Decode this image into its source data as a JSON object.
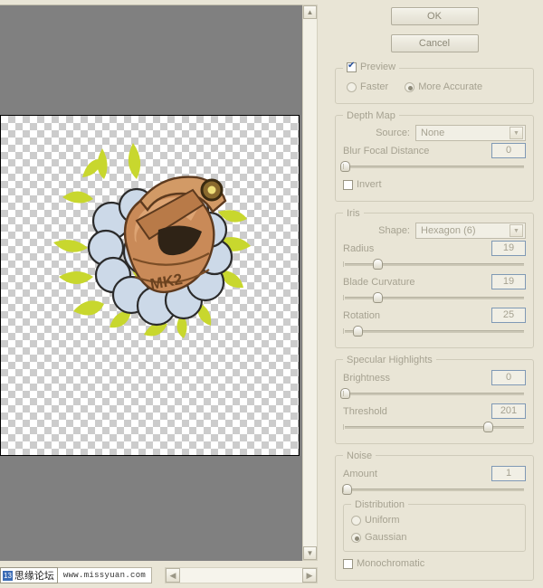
{
  "dialog": {
    "ok_label": "OK",
    "cancel_label": "Cancel"
  },
  "preview": {
    "checkbox_label": "Preview",
    "checked": true,
    "quality_options": [
      "Faster",
      "More Accurate"
    ],
    "faster_label": "Faster",
    "more_accurate_label": "More Accurate",
    "selected_quality": "More Accurate"
  },
  "depth_map": {
    "title": "Depth Map",
    "source_label": "Source:",
    "source_value": "None",
    "blur_focal_distance_label": "Blur Focal Distance",
    "blur_focal_distance_value": "0",
    "blur_focal_distance_percent": 1,
    "invert_label": "Invert",
    "invert_checked": false
  },
  "iris": {
    "title": "Iris",
    "shape_label": "Shape:",
    "shape_value": "Hexagon (6)",
    "radius_label": "Radius",
    "radius_value": "19",
    "radius_percent": 19,
    "blade_curvature_label": "Blade Curvature",
    "blade_curvature_value": "19",
    "blade_curvature_percent": 19,
    "rotation_label": "Rotation",
    "rotation_value": "25",
    "rotation_percent": 8
  },
  "specular_highlights": {
    "title": "Specular Highlights",
    "brightness_label": "Brightness",
    "brightness_value": "0",
    "brightness_percent": 1,
    "threshold_label": "Threshold",
    "threshold_value": "201",
    "threshold_percent": 79
  },
  "noise": {
    "title": "Noise",
    "amount_label": "Amount",
    "amount_value": "1",
    "amount_percent": 2,
    "distribution_title": "Distribution",
    "uniform_label": "Uniform",
    "gaussian_label": "Gaussian",
    "selected_distribution": "Gaussian",
    "monochromatic_label": "Monochromatic",
    "monochromatic_checked": false
  },
  "canvas": {
    "artwork_label": "MK2",
    "background": "transparent-checkerboard"
  },
  "watermark": {
    "index": "13",
    "forum_name": "思缘论坛",
    "url": "www.missyuan.com"
  },
  "icons": {
    "scroll_up": "▲",
    "scroll_down": "▼",
    "scroll_left": "◀",
    "scroll_right": "▶",
    "chevron_down": "▼"
  },
  "colors": {
    "panel_bg": "#e9e5d6",
    "preview_bg": "#808080",
    "text": "#a6a291",
    "numbox_border": "#7f99b5",
    "check_blue": "#27509b"
  }
}
